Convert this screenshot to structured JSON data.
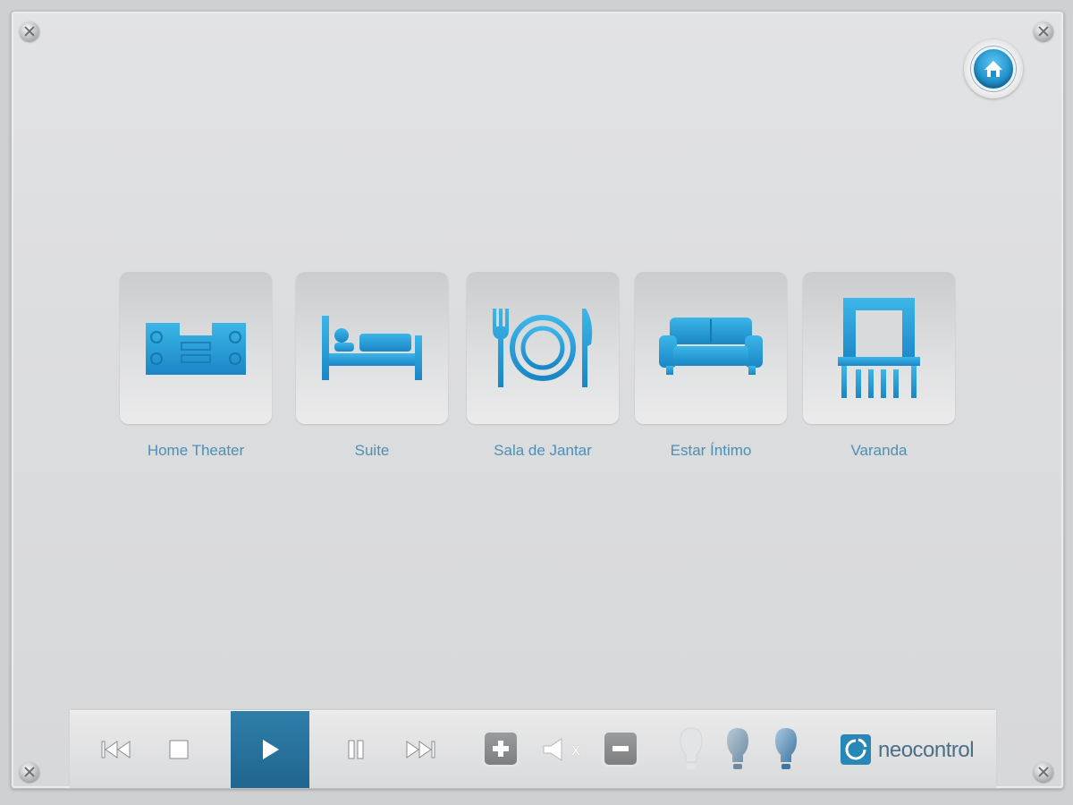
{
  "rooms": [
    {
      "label": "Home Theater",
      "icon": "home-theater-icon"
    },
    {
      "label": "Suite",
      "icon": "bed-icon"
    },
    {
      "label": "Sala de Jantar",
      "icon": "dining-plate-icon"
    },
    {
      "label": "Estar Íntimo",
      "icon": "sofa-icon"
    },
    {
      "label": "Varanda",
      "icon": "balcony-icon"
    }
  ],
  "controls": {
    "mute_x": "x"
  },
  "brand": {
    "name": "neocontrol"
  },
  "colors": {
    "accent": "#2f7eaa",
    "icon_blue": "#2a9fd6",
    "label_blue": "#4e8fb3"
  }
}
